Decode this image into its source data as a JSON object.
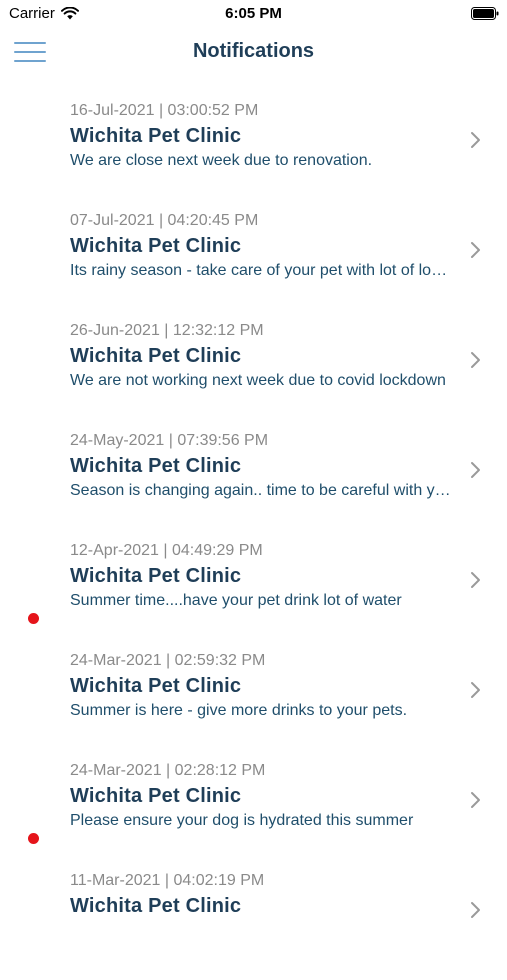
{
  "status_bar": {
    "carrier": "Carrier",
    "time": "6:05 PM"
  },
  "header": {
    "title": "Notifications"
  },
  "notifications": [
    {
      "date": "16-Jul-2021 | 03:00:52 PM",
      "sender": "Wichita Pet Clinic",
      "message": "We are close next week due to renovation.",
      "unread": false
    },
    {
      "date": "07-Jul-2021 | 04:20:45 PM",
      "sender": "Wichita Pet Clinic",
      "message": "Its rainy season - take care of your pet with lot of love and care",
      "unread": false
    },
    {
      "date": "26-Jun-2021 | 12:32:12 PM",
      "sender": "Wichita Pet Clinic",
      "message": "We are not working next week due to covid lockdown",
      "unread": false
    },
    {
      "date": "24-May-2021 | 07:39:56 PM",
      "sender": "Wichita Pet Clinic",
      "message": "Season is changing again.. time to be careful with your pets",
      "unread": false
    },
    {
      "date": "12-Apr-2021 | 04:49:29 PM",
      "sender": "Wichita Pet Clinic",
      "message": "Summer time....have your pet drink lot of water",
      "unread": true
    },
    {
      "date": "24-Mar-2021 | 02:59:32 PM",
      "sender": "Wichita Pet Clinic",
      "message": "Summer is here - give more drinks to your pets.",
      "unread": false
    },
    {
      "date": "24-Mar-2021 | 02:28:12 PM",
      "sender": "Wichita Pet Clinic",
      "message": "Please ensure your dog is hydrated this summer",
      "unread": true
    },
    {
      "date": "11-Mar-2021 | 04:02:19 PM",
      "sender": "Wichita Pet Clinic",
      "message": "",
      "unread": false
    }
  ],
  "colors": {
    "title": "#1f3e58",
    "message": "#1f4e6b",
    "date": "#8a8a8a",
    "unread_dot": "#e5141a",
    "menu_icon": "#6fa3cf"
  },
  "icons": {
    "menu": "hamburger-menu-icon",
    "wifi": "wifi-icon",
    "battery": "battery-icon",
    "row": "chevron-right-icon"
  }
}
